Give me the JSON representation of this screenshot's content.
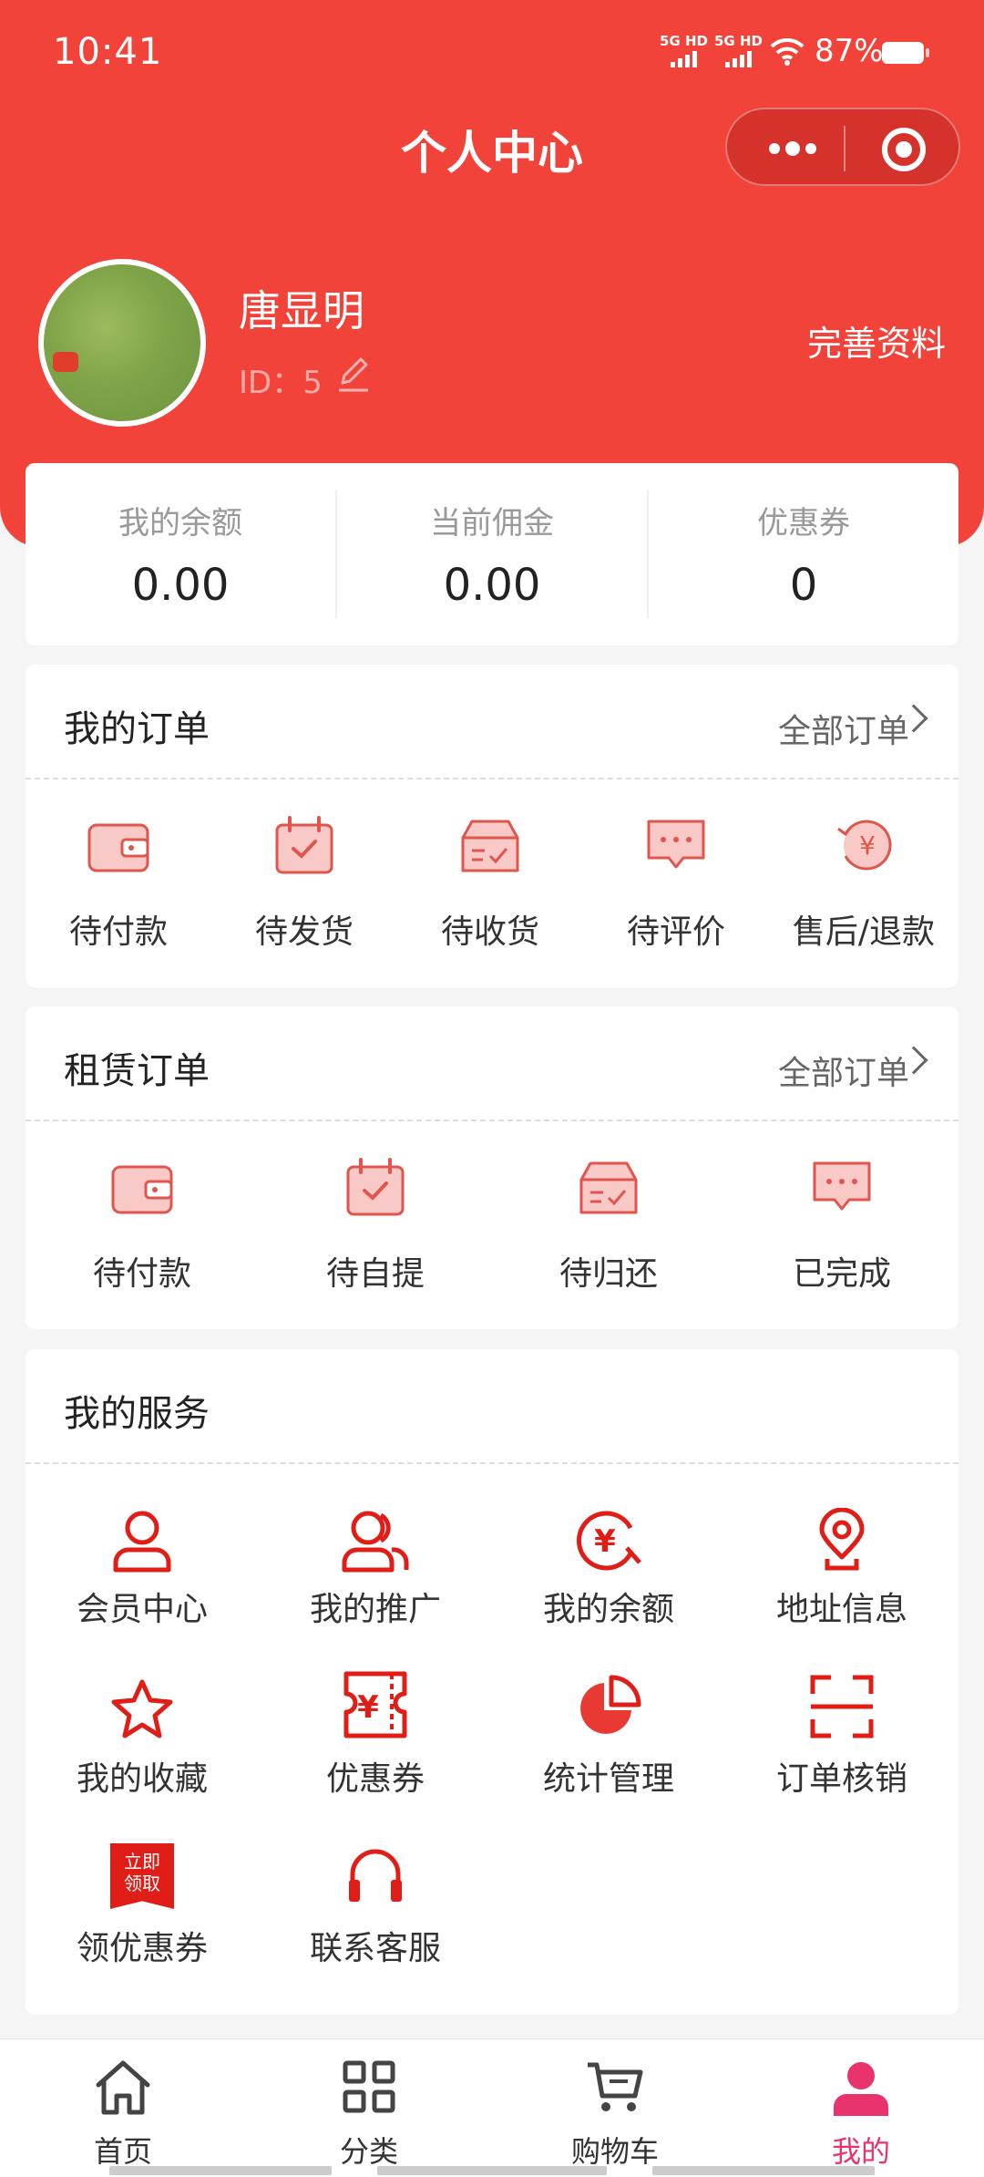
{
  "status": {
    "time": "10:41",
    "net1": "5G HD",
    "net2": "5G HD",
    "battery": "87%"
  },
  "header": {
    "title": "个人中心"
  },
  "profile": {
    "name": "唐显明",
    "id_label": "ID：",
    "id_value": "5",
    "complete_label": "完善资料"
  },
  "stats": [
    {
      "label": "我的余额",
      "value": "0.00"
    },
    {
      "label": "当前佣金",
      "value": "0.00"
    },
    {
      "label": "优惠券",
      "value": "0"
    }
  ],
  "orders": {
    "title": "我的订单",
    "more": "全部订单",
    "items": [
      {
        "label": "待付款",
        "icon": "wallet-icon"
      },
      {
        "label": "待发货",
        "icon": "calendar-check-icon"
      },
      {
        "label": "待收货",
        "icon": "box-icon"
      },
      {
        "label": "待评价",
        "icon": "comment-icon"
      },
      {
        "label": "售后/退款",
        "icon": "refund-icon"
      }
    ]
  },
  "rental": {
    "title": "租赁订单",
    "more": "全部订单",
    "items": [
      {
        "label": "待付款",
        "icon": "wallet-icon"
      },
      {
        "label": "待自提",
        "icon": "calendar-check-icon"
      },
      {
        "label": "待归还",
        "icon": "box-icon"
      },
      {
        "label": "已完成",
        "icon": "comment-icon"
      }
    ]
  },
  "services": {
    "title": "我的服务",
    "items": [
      {
        "label": "会员中心",
        "icon": "user-icon"
      },
      {
        "label": "我的推广",
        "icon": "users-icon"
      },
      {
        "label": "我的余额",
        "icon": "yuan-circle-icon"
      },
      {
        "label": "地址信息",
        "icon": "location-icon"
      },
      {
        "label": "我的收藏",
        "icon": "star-icon"
      },
      {
        "label": "优惠券",
        "icon": "coupon-icon"
      },
      {
        "label": "统计管理",
        "icon": "pie-chart-icon"
      },
      {
        "label": "订单核销",
        "icon": "scan-icon"
      },
      {
        "label": "领优惠券",
        "icon": "get-coupon-icon",
        "badge": "立即\n领取"
      },
      {
        "label": "联系客服",
        "icon": "headset-icon"
      }
    ]
  },
  "tabbar": [
    {
      "label": "首页",
      "icon": "home-icon"
    },
    {
      "label": "分类",
      "icon": "grid-icon"
    },
    {
      "label": "购物车",
      "icon": "cart-icon"
    },
    {
      "label": "我的",
      "icon": "profile-icon",
      "active": true
    }
  ],
  "colors": {
    "brand": "#f2433a",
    "accent_pink": "#e8336d",
    "icon_red": "#e01d16",
    "icon_light": "#f8c9c7"
  }
}
